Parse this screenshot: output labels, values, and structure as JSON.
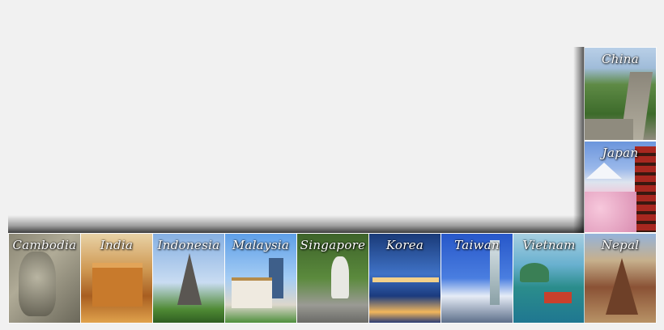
{
  "tiles": [
    {
      "name": "China",
      "colors": [
        "#a9c7e6",
        "#4f7a3a",
        "#6d6d62"
      ]
    },
    {
      "name": "Japan",
      "colors": [
        "#6f96d9",
        "#f4b9d2",
        "#b23a2c"
      ]
    },
    {
      "name": "Cambodia",
      "colors": [
        "#7d7a6a",
        "#a8a491",
        "#4b4a40"
      ]
    },
    {
      "name": "India",
      "colors": [
        "#d7b47a",
        "#c27c2a",
        "#6d3b14"
      ]
    },
    {
      "name": "Indonesia",
      "colors": [
        "#8fb6e5",
        "#5e5a57",
        "#3f7f2c"
      ]
    },
    {
      "name": "Malaysia",
      "colors": [
        "#78b3ee",
        "#e8e4dc",
        "#4b6d96"
      ]
    },
    {
      "name": "Singapore",
      "colors": [
        "#466b2f",
        "#dcdcd6",
        "#a8a8a3"
      ]
    },
    {
      "name": "Korea",
      "colors": [
        "#1b3e7d",
        "#4b8be0",
        "#f0c46a"
      ]
    },
    {
      "name": "Taiwan",
      "colors": [
        "#2e5fd0",
        "#ffffff",
        "#5d6f8a"
      ]
    },
    {
      "name": "Vietnam",
      "colors": [
        "#6bb3cf",
        "#2d8f88",
        "#c9402c"
      ]
    },
    {
      "name": "Nepal",
      "colors": [
        "#8fb0d8",
        "#8a5235",
        "#c7b08c"
      ]
    }
  ]
}
